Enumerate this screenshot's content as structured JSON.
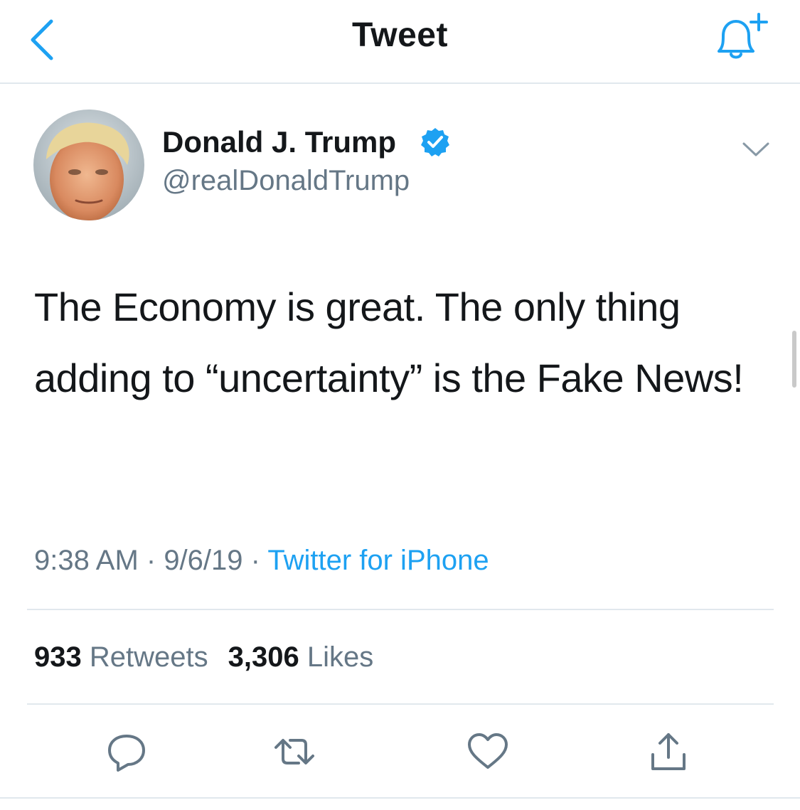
{
  "header": {
    "title": "Tweet",
    "back_icon": "chevron-left-icon",
    "bell_icon": "bell-plus-icon"
  },
  "author": {
    "name": "Donald J. Trump",
    "handle": "@realDonaldTrump",
    "verified": true,
    "verified_icon": "verified-badge-icon"
  },
  "tweet": {
    "text": "The Economy is great. The only thing adding to “uncertainty” is the Fake News!"
  },
  "meta": {
    "time": "9:38 AM",
    "separator": " · ",
    "date": "9/6/19",
    "source": "Twitter for iPhone"
  },
  "stats": {
    "retweets_count": "933",
    "retweets_label": "Retweets",
    "likes_count": "3,306",
    "likes_label": "Likes"
  },
  "actions": {
    "reply_icon": "reply-icon",
    "retweet_icon": "retweet-icon",
    "like_icon": "heart-icon",
    "share_icon": "share-icon"
  },
  "colors": {
    "accent": "#1da1f2",
    "text_primary": "#14171a",
    "text_secondary": "#657786",
    "divider": "#e1e8ed"
  }
}
